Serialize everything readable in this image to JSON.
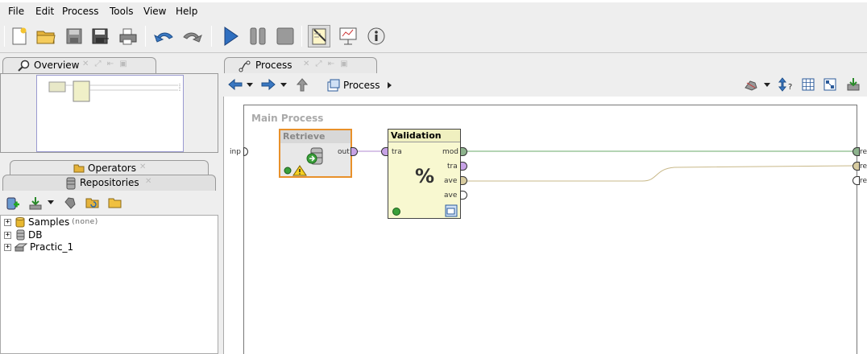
{
  "menu": [
    "File",
    "Edit",
    "Process",
    "Tools",
    "View",
    "Help"
  ],
  "toolbar": {
    "buttons": [
      "new-icon",
      "open-icon",
      "save-icon",
      "save-as-icon",
      "print-icon",
      "undo-icon",
      "redo-icon",
      "run-icon",
      "pause-icon",
      "stop-icon",
      "design-perspective-icon",
      "result-perspective-icon",
      "welcome-perspective-icon"
    ]
  },
  "overview": {
    "tab_label": "Overview"
  },
  "operators": {
    "tab_label": "Operators"
  },
  "repositories": {
    "tab_label": "Repositories",
    "items": [
      {
        "label": "Samples",
        "meta": "(none)",
        "icon": "cylinder-icon"
      },
      {
        "label": "DB",
        "meta": "",
        "icon": "database-icon"
      },
      {
        "label": "Practic_1",
        "meta": "",
        "icon": "drive-icon"
      }
    ]
  },
  "process": {
    "tab_label": "Process",
    "breadcrumb": "Process",
    "canvas_title": "Main Process",
    "input_port": "inp",
    "result_ports": [
      "re",
      "re",
      "re"
    ],
    "operators": [
      {
        "title": "Retrieve",
        "out_ports": [
          "out"
        ]
      },
      {
        "title": "Validation",
        "in_ports": [
          "tra"
        ],
        "out_ports": [
          "mod",
          "tra",
          "ave",
          "ave"
        ],
        "symbol": "%"
      }
    ]
  },
  "colors": {
    "operator_fill": "#f8f8d0",
    "selected_border": "#e8902a",
    "model_port": "#8db38d",
    "data_port": "#c7a2e6",
    "perf_port": "#d8cca0"
  }
}
